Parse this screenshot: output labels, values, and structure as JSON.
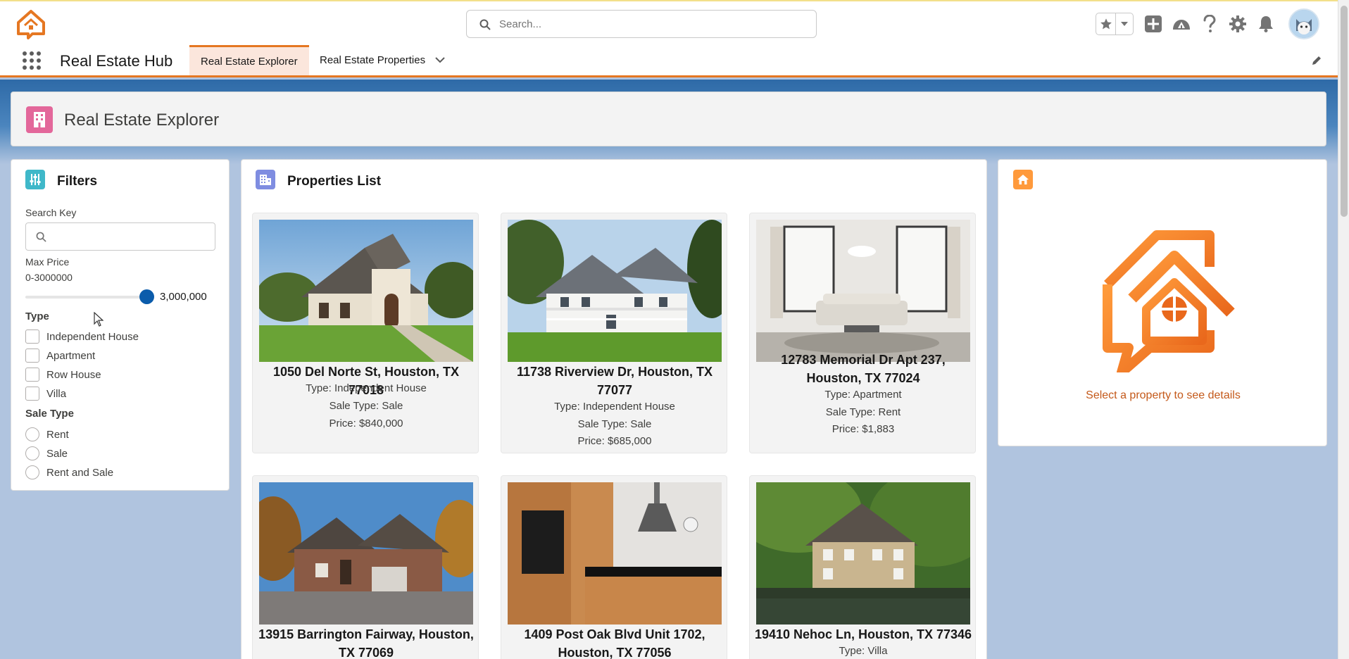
{
  "header": {
    "search_placeholder": "Search...",
    "icons": [
      "app-logo-icon",
      "star-icon",
      "chevron-down-icon",
      "add-icon",
      "trailhead-icon",
      "help-icon",
      "gear-icon",
      "bell-icon",
      "avatar"
    ]
  },
  "nav": {
    "app_name": "Real Estate Hub",
    "tabs": [
      {
        "label": "Real Estate Explorer",
        "active": true
      },
      {
        "label": "Real Estate Properties",
        "active": false
      }
    ]
  },
  "page": {
    "title": "Real Estate Explorer"
  },
  "filters": {
    "title": "Filters",
    "search_label": "Search Key",
    "max_price_label": "Max Price",
    "price_range": "0-3000000",
    "slider_value_text": "3,000,000",
    "slider_fraction": 1.0,
    "type_label": "Type",
    "types": [
      "Independent House",
      "Apartment",
      "Row House",
      "Villa"
    ],
    "sale_type_label": "Sale Type",
    "sale_types": [
      "Rent",
      "Sale",
      "Rent and Sale"
    ]
  },
  "properties": {
    "title": "Properties List",
    "items": [
      {
        "address": "1050 Del Norte St, Houston, TX 77018",
        "type": "Type: Independent House",
        "sale_type": "Sale Type: Sale",
        "price": "Price: $840,000"
      },
      {
        "address": "11738 Riverview Dr, Houston, TX 77077",
        "type": "Type: Independent House",
        "sale_type": "Sale Type: Sale",
        "price": "Price: $685,000"
      },
      {
        "address": "12783 Memorial Dr Apt 237, Houston, TX 77024",
        "type": "Type: Apartment",
        "sale_type": "Sale Type: Rent",
        "price": "Price: $1,883"
      },
      {
        "address": "13915 Barrington Fairway, Houston, TX 77069",
        "type": "",
        "sale_type": "",
        "price": ""
      },
      {
        "address": "1409 Post Oak Blvd Unit 1702, Houston, TX 77056",
        "type": "",
        "sale_type": "",
        "price": ""
      },
      {
        "address": "19410 Nehoc Ln, Houston, TX 77346",
        "type": "Type: Villa",
        "sale_type": "",
        "price": ""
      }
    ]
  },
  "details": {
    "hint": "Select a property to see details"
  },
  "colors": {
    "accent": "#e57722",
    "brand_blue": "#0b5cab",
    "page_icon": "#e3679a",
    "filters_icon": "#3fb8c9",
    "list_icon": "#7f8de1",
    "details_icon": "#ff9a3c"
  }
}
